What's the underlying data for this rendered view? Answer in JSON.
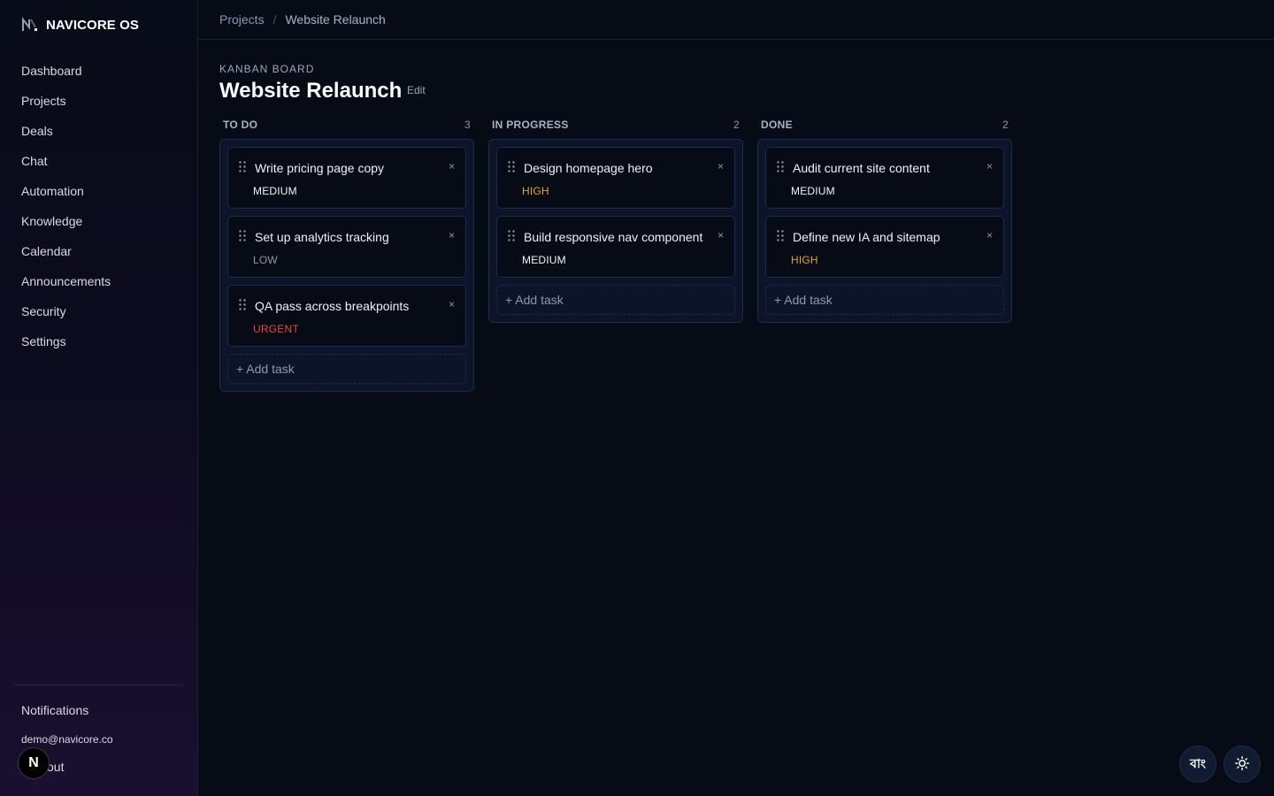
{
  "brand": {
    "name": "NAVICORE OS"
  },
  "nav": {
    "items": [
      {
        "label": "Dashboard"
      },
      {
        "label": "Projects"
      },
      {
        "label": "Deals"
      },
      {
        "label": "Chat"
      },
      {
        "label": "Automation"
      },
      {
        "label": "Knowledge"
      },
      {
        "label": "Calendar"
      },
      {
        "label": "Announcements"
      },
      {
        "label": "Security"
      },
      {
        "label": "Settings"
      }
    ]
  },
  "sidebar_footer": {
    "notifications": "Notifications",
    "email": "demo@navicore.co",
    "logout": "out",
    "badge": "N"
  },
  "breadcrumb": {
    "parent": "Projects",
    "separator": "/",
    "current": "Website Relaunch"
  },
  "board": {
    "kicker": "KANBAN BOARD",
    "title": "Website Relaunch",
    "edit": "Edit"
  },
  "columns": [
    {
      "name": "TO DO",
      "count": "3",
      "cards": [
        {
          "title": "Write pricing page copy",
          "priority": "MEDIUM",
          "close": "×"
        },
        {
          "title": "Set up analytics tracking",
          "priority": "LOW",
          "close": "×"
        },
        {
          "title": "QA pass across breakpoints",
          "priority": "URGENT",
          "close": "×"
        }
      ],
      "add": "+ Add task"
    },
    {
      "name": "IN PROGRESS",
      "count": "2",
      "cards": [
        {
          "title": "Design homepage hero",
          "priority": "HIGH",
          "close": "×"
        },
        {
          "title": "Build responsive nav component",
          "priority": "MEDIUM",
          "close": "×"
        }
      ],
      "add": "+ Add task"
    },
    {
      "name": "DONE",
      "count": "2",
      "cards": [
        {
          "title": "Audit current site content",
          "priority": "MEDIUM",
          "close": "×"
        },
        {
          "title": "Define new IA and sitemap",
          "priority": "HIGH",
          "close": "×"
        }
      ],
      "add": "+ Add task"
    }
  ],
  "floating": {
    "language": "বাং"
  },
  "colors": {
    "background": "#070b16",
    "priority_high": "#e6a329",
    "priority_urgent": "#ef4444",
    "priority_low": "#8d97b0",
    "priority_medium": "#f2f4f8"
  },
  "icons": [
    "logo-icon",
    "drag-handle-icon",
    "close-icon",
    "sun-icon"
  ]
}
